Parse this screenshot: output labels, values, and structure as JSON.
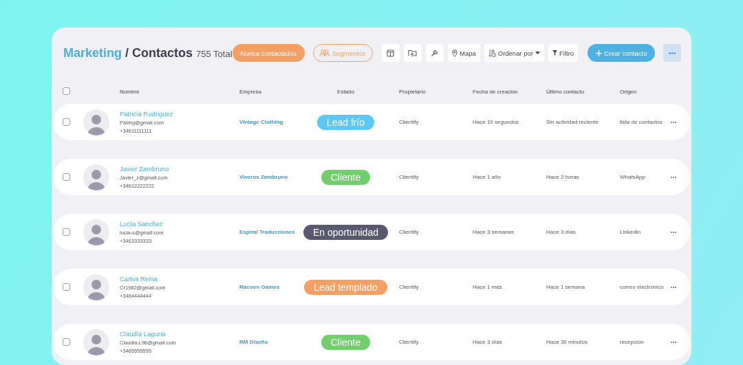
{
  "breadcrumb": {
    "section": "Marketing",
    "page": "/ Contactos",
    "count": "755 Total"
  },
  "toolbar": [
    {
      "kind": "filled-pill",
      "label": "Nunca contactados"
    },
    {
      "kind": "segments",
      "label": "Segmentos"
    },
    {
      "kind": "layout"
    },
    {
      "kind": "upload"
    },
    {
      "kind": "wrench"
    },
    {
      "kind": "map",
      "label": "Mapa"
    },
    {
      "kind": "sort",
      "label": "Ordenar por"
    },
    {
      "kind": "filter",
      "label": "Filtro"
    },
    {
      "kind": "create",
      "label": "Crear contacto"
    },
    {
      "kind": "more"
    }
  ],
  "select_all": {
    "checked": false
  },
  "columns": [
    "Nombre",
    "Empresa",
    "Estado",
    "Propietario",
    "Fecha de creación",
    "Último contacto",
    "Origen"
  ],
  "rows": [
    {
      "checked": false,
      "name": "Patricia Rodriguez",
      "email": "Patrirg@gmail.com",
      "phone": "+34611111111",
      "company": "Vintage Clothing",
      "status": {
        "label": "Lead frío",
        "color": "#5bc8f5"
      },
      "owner": "Clientify",
      "created": "Hace 10 segundos",
      "last_contact": "Sin actividad reciente",
      "origin": "lista de contactos"
    },
    {
      "checked": false,
      "name": "Javier Zambruno",
      "email": "Javier_z@gmail.com",
      "phone": "+34612222222",
      "company": "Viveros Zambruno",
      "status": {
        "label": "Cliente",
        "color": "#6fcf6a"
      },
      "owner": "Clientify",
      "created": "Hace 1 año",
      "last_contact": "Hace 2 horas",
      "origin": "WhatsApp"
    },
    {
      "checked": false,
      "name": "Lucía Sanchez",
      "email": "lucia-s@gmail.com",
      "phone": "+3463333333",
      "company": "Espiral Traducciones",
      "status": {
        "label": "En oportunidad",
        "color": "#5a5870"
      },
      "owner": "Clientify",
      "created": "Hace 3 semanas",
      "last_contact": "Hace 3 días",
      "origin": "LinkedIn"
    },
    {
      "checked": false,
      "name": "Carlos Reina",
      "email": "Cr1982@gmail.com",
      "phone": "+3464444444",
      "company": "Racoon Games",
      "status": {
        "label": "Lead templado",
        "color": "#f4a063"
      },
      "owner": "Clientify",
      "created": "Hace 1 mes",
      "last_contact": "Hace 1 semana",
      "origin": "correo electrónico"
    },
    {
      "checked": false,
      "name": "Claudia Laguna",
      "email": "Claudia.L96@gmail.com",
      "phone": "+3465555555",
      "company": "RM Diseño",
      "status": {
        "label": "Cliente",
        "color": "#6fcf6a"
      },
      "owner": "Clientify",
      "created": "Hace 3 días",
      "last_contact": "Hace 30 minutos",
      "origin": "recepción"
    }
  ]
}
